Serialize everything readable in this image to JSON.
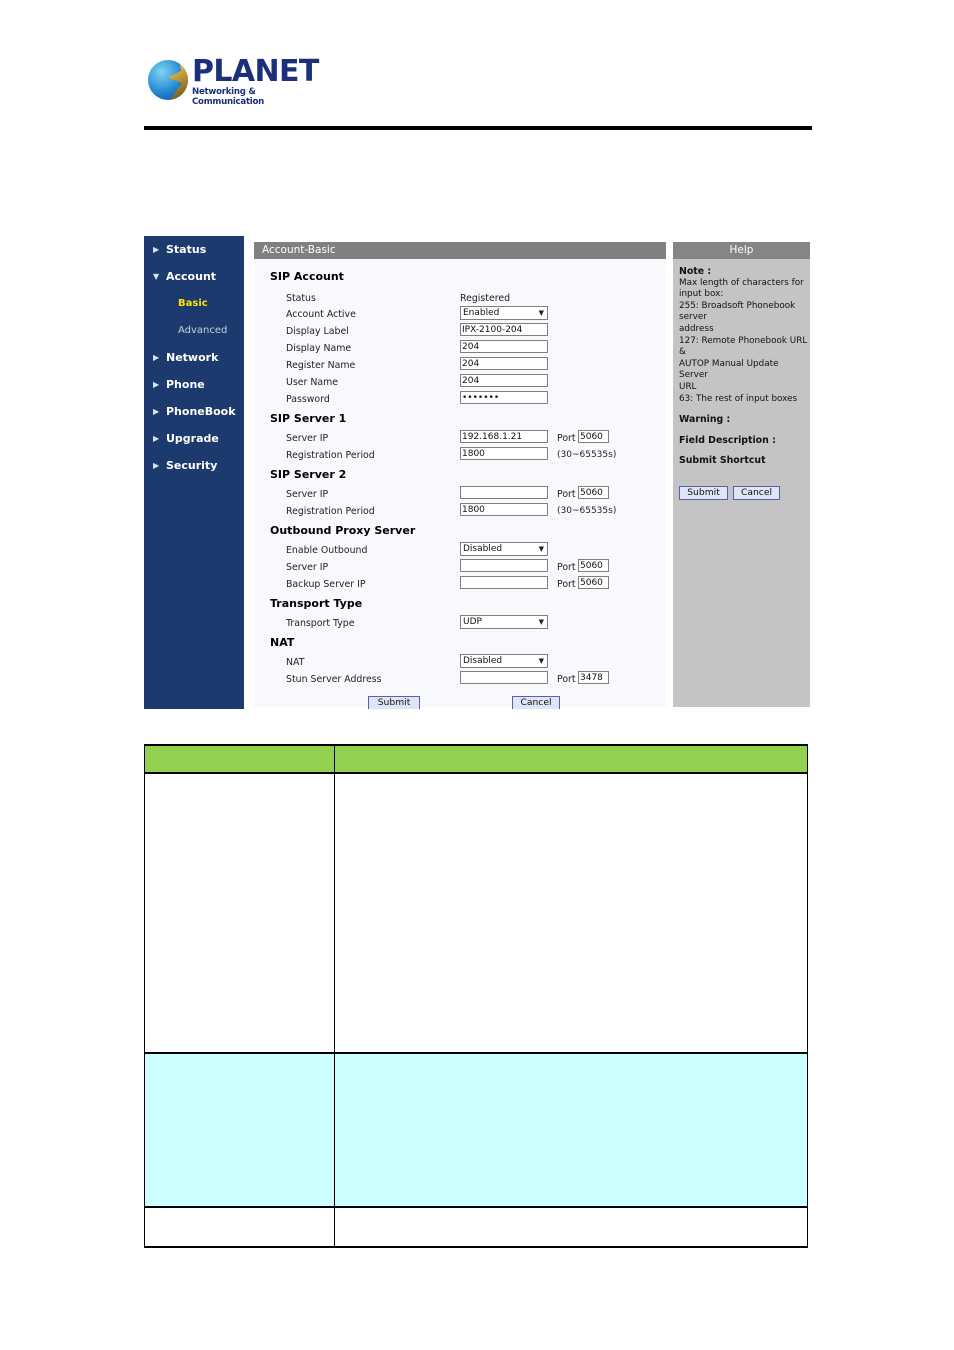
{
  "document": {
    "brand": {
      "name": "PLANET",
      "tagline": "Networking & Communication",
      "logo_icon": "planet-globe-logo",
      "brand_color": "#1b2f7a"
    }
  },
  "ui_screenshot": {
    "sidebar": {
      "background": "#1d3a6e",
      "items": [
        {
          "label": "Status",
          "icon": "chevron-right-icon",
          "expanded": false,
          "type": "top"
        },
        {
          "label": "Account",
          "icon": "chevron-down-icon",
          "expanded": true,
          "type": "top"
        },
        {
          "label": "Basic",
          "type": "sub",
          "active": true
        },
        {
          "label": "Advanced",
          "type": "sub",
          "active": false
        },
        {
          "label": "Network",
          "icon": "chevron-right-icon",
          "expanded": false,
          "type": "top"
        },
        {
          "label": "Phone",
          "icon": "chevron-right-icon",
          "expanded": false,
          "type": "top"
        },
        {
          "label": "PhoneBook",
          "icon": "chevron-right-icon",
          "expanded": false,
          "type": "top"
        },
        {
          "label": "Upgrade",
          "icon": "chevron-right-icon",
          "expanded": false,
          "type": "top"
        },
        {
          "label": "Security",
          "icon": "chevron-right-icon",
          "expanded": false,
          "type": "top"
        }
      ],
      "active_item_color": "#ffe400"
    },
    "panel": {
      "title": "Account-Basic",
      "title_bar_color": "#808080",
      "sections": {
        "sip_account": {
          "heading": "SIP Account",
          "status_label": "Status",
          "status_value": "Registered",
          "account_active_label": "Account Active",
          "account_active_value": "Enabled",
          "display_label_label": "Display Label",
          "display_label_value": "IPX-2100-204",
          "display_name_label": "Display Name",
          "display_name_value": "204",
          "register_name_label": "Register Name",
          "register_name_value": "204",
          "user_name_label": "User Name",
          "user_name_value": "204",
          "password_label": "Password",
          "password_value": "•••••••"
        },
        "sip_server_1": {
          "heading": "SIP Server 1",
          "server_ip_label": "Server IP",
          "server_ip_value": "192.168.1.21",
          "port_label": "Port",
          "port_value": "5060",
          "registration_period_label": "Registration Period",
          "registration_period_value": "1800",
          "registration_period_hint": "(30~65535s)"
        },
        "sip_server_2": {
          "heading": "SIP Server 2",
          "server_ip_label": "Server IP",
          "server_ip_value": "",
          "port_label": "Port",
          "port_value": "5060",
          "registration_period_label": "Registration Period",
          "registration_period_value": "1800",
          "registration_period_hint": "(30~65535s)"
        },
        "outbound_proxy": {
          "heading": "Outbound Proxy Server",
          "enable_outbound_label": "Enable Outbound",
          "enable_outbound_value": "Disabled",
          "server_ip_label": "Server IP",
          "server_ip_value": "",
          "server_port_label": "Port",
          "server_port_value": "5060",
          "backup_server_ip_label": "Backup Server IP",
          "backup_server_ip_value": "",
          "backup_port_label": "Port",
          "backup_port_value": "5060"
        },
        "transport": {
          "heading": "Transport Type",
          "transport_type_label": "Transport Type",
          "transport_type_value": "UDP"
        },
        "nat": {
          "heading": "NAT",
          "nat_label": "NAT",
          "nat_value": "Disabled",
          "stun_server_label": "Stun Server Address",
          "stun_server_value": "",
          "stun_port_label": "Port",
          "stun_port_value": "3478"
        }
      },
      "submit_label": "Submit",
      "cancel_label": "Cancel"
    },
    "help": {
      "title": "Help",
      "note_heading": "Note :",
      "note_lines": [
        "Max length of characters for",
        "input box:",
        "255: Broadsoft Phonebook server",
        "address",
        "127: Remote Phonebook URL &",
        "AUTOP Manual Update Server",
        "URL",
        "63: The rest of input boxes"
      ],
      "warning_heading": "Warning :",
      "field_description_heading": "Field Description :",
      "submit_shortcut_heading": "Submit Shortcut",
      "submit_label": "Submit",
      "cancel_label": "Cancel"
    }
  },
  "description_table": {
    "header_color": "#92d050",
    "highlight_color": "#ccffff",
    "rows": [
      {
        "col1": "",
        "col2": "",
        "type": "header"
      },
      {
        "col1": "",
        "col2": "",
        "type": "body"
      },
      {
        "col1": "",
        "col2": "",
        "type": "highlight"
      },
      {
        "col1": "",
        "col2": "",
        "type": "last"
      }
    ]
  }
}
